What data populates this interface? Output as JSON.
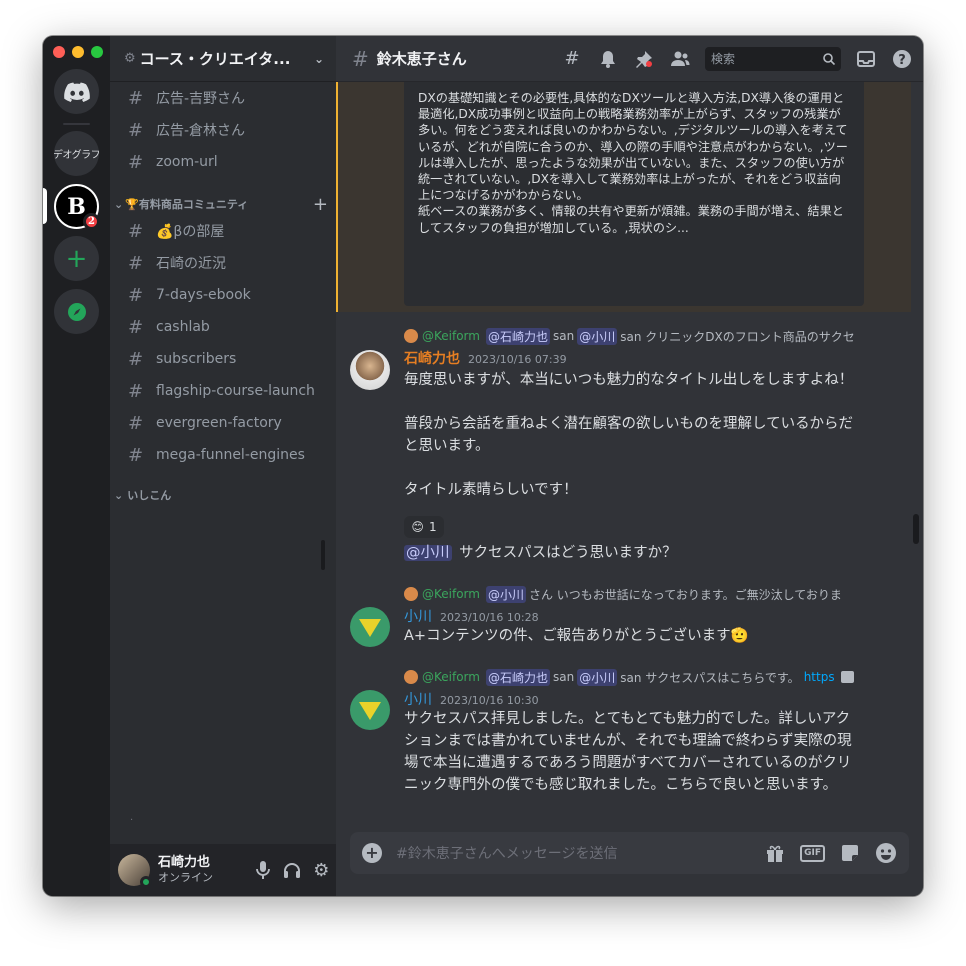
{
  "server_rail": {
    "text_server_label": "デオグラフ",
    "b_server_letter": "B",
    "b_server_badge": "2"
  },
  "sidebar": {
    "guild_name": "コース・クリエイタ...",
    "channels_top": [
      "広告-吉野さん",
      "広告-倉林さん",
      "zoom-url"
    ],
    "category_1": "有料商品コミュニティ",
    "category_1_emoji": "🏆",
    "channels_cat1": [
      "💰βの部屋",
      "石崎の近況",
      "7-days-ebook",
      "cashlab",
      "subscribers",
      "flagship-course-launch",
      "evergreen-factory",
      "mega-funnel-engines"
    ],
    "category_2": "いしこん",
    "stray_mark": "."
  },
  "user_panel": {
    "name": "石崎力也",
    "status": "オンライン"
  },
  "topbar": {
    "channel_name": "鈴木恵子さん",
    "search_placeholder": "検索"
  },
  "embed": {
    "text": "DXの基礎知識とその必要性,具体的なDXツールと導入方法,DX導入後の運用と最適化,DX成功事例と収益向上の戦略業務効率が上がらず、スタッフの残業が多い。何をどう変えれば良いのかわからない。,デジタルツールの導入を考えているが、どれが自院に合うのか、導入の際の手順や注意点がわからない。,ツールは導入したが、思ったような効果が出ていない。また、スタッフの使い方が統一されていない。,DXを導入して業務効率は上がったが、それをどう収益向上につなげるかがわからない。\n紙ベースの業務が多く、情報の共有や更新が煩雑。業務の手間が増え、結果としてスタッフの負担が増加している。,現状のシ..."
  },
  "messages": [
    {
      "reply_author": "@Keiform",
      "reply_mention_1": "@石崎力也",
      "reply_mid_1": "san",
      "reply_mention_2": "@小川",
      "reply_text": "san クリニックDXのフロント商品のサクセ",
      "author": "石崎力也",
      "author_color": "#e67e22",
      "time": "2023/10/16 07:39",
      "body_lines": [
        "毎度思いますが、本当にいつも魅力的なタイトル出しをしますよね！",
        "",
        "普段から会話を重ねよく潜在顧客の欲しいものを理解しているからだと思います。",
        "",
        "タイトル素晴らしいです！"
      ],
      "reaction_emoji": "😊",
      "reaction_count": "1",
      "followup_mention": "@小川",
      "followup_text": " サクセスパスはどう思いますか？"
    },
    {
      "reply_author": "@Keiform",
      "reply_mention_1": "@小川",
      "reply_text": "さん いつもお世話になっております。ご無沙汰しておりま",
      "author": "小川",
      "author_color": "#3498db",
      "time": "2023/10/16 10:28",
      "body": "A+コンテンツの件、ご報告ありがとうございます🫡"
    },
    {
      "reply_author": "@Keiform",
      "reply_mention_1": "@石崎力也",
      "reply_mid_1": "san",
      "reply_mention_2": "@小川",
      "reply_text": "san サクセスパスはこちらです。",
      "reply_link": "https",
      "author": "小川",
      "author_color": "#3498db",
      "time": "2023/10/16 10:30",
      "body": "サクセスパス拝見しました。とてもとても魅力的でした。詳しいアクションまでは書かれていませんが、それでも理論で終わらず実際の現場で本当に遭遇するであろう問題がすべてカバーされているのがクリニック専門外の僕でも感じ取れました。こちらで良いと思います。"
    }
  ],
  "composer": {
    "placeholder": "#鈴木恵子さんへメッセージを送信",
    "gif_label": "GIF"
  },
  "colors": {
    "traffic_red": "#ff5f57",
    "traffic_yellow": "#febc2e",
    "traffic_green": "#28c840",
    "embed_border": "#f0b232",
    "online": "#23a55a"
  }
}
